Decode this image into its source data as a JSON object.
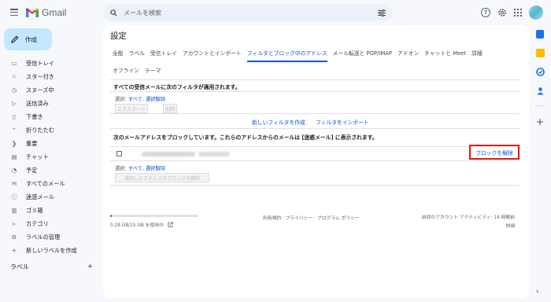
{
  "header": {
    "app_name": "Gmail",
    "search_placeholder": "メールを検索"
  },
  "compose_label": "作成",
  "nav": [
    {
      "icon": "inbox-icon",
      "glyph": "▭",
      "label": "受信トレイ"
    },
    {
      "icon": "star-icon",
      "glyph": "☆",
      "label": "スター付き"
    },
    {
      "icon": "snooze-icon",
      "glyph": "◷",
      "label": "スヌーズ中"
    },
    {
      "icon": "send-icon",
      "glyph": "▷",
      "label": "送信済み"
    },
    {
      "icon": "draft-icon",
      "glyph": "▯",
      "label": "下書き"
    },
    {
      "icon": "collapse-icon",
      "glyph": "⌃",
      "label": "折りたたむ"
    },
    {
      "icon": "important-icon",
      "glyph": "❯",
      "label": "重要"
    },
    {
      "icon": "chat-icon",
      "glyph": "▤",
      "label": "チャット"
    },
    {
      "icon": "scheduled-icon",
      "glyph": "◔",
      "label": "予定"
    },
    {
      "icon": "all-mail-icon",
      "glyph": "✉",
      "label": "すべてのメール"
    },
    {
      "icon": "spam-icon",
      "glyph": "ⓘ",
      "label": "迷惑メール"
    },
    {
      "icon": "trash-icon",
      "glyph": "▥",
      "label": "ゴミ箱"
    },
    {
      "icon": "category-icon",
      "glyph": "▹",
      "label": "カテゴリ"
    },
    {
      "icon": "manage-labels-icon",
      "glyph": "⚙",
      "label": "ラベルの管理"
    },
    {
      "icon": "add-label-icon",
      "glyph": "+",
      "label": "新しいラベルを作成"
    }
  ],
  "labels_heading": "ラベル",
  "labels_add": "+",
  "settings": {
    "title": "設定",
    "tabs": [
      "全般",
      "ラベル",
      "受信トレイ",
      "アカウントとインポート",
      "フィルタとブロック中のアドレス",
      "メール転送と POP/IMAP",
      "アドオン",
      "チャットと Meet",
      "詳細"
    ],
    "active_tab": 4,
    "tabs_row2": [
      "オフライン",
      "テーマ"
    ],
    "filters_heading": "すべての受信メールに次のフィルタが適用されます。",
    "select_label": "選択:",
    "select_all": "すべて",
    "select_none": "選択解除",
    "export_button": "エクスポート",
    "delete_button": "削除",
    "create_filter_link": "新しいフィルタを作成",
    "import_filter_link": "フィルタをインポート",
    "blocked_heading": "次のメールアドレスをブロックしています。これらのアドレスからのメールは [迷惑メール] に表示されます。",
    "unblock_link": "ブロックを解除",
    "unblock_selected_button": "選択したアドレスのブロックを解除"
  },
  "footer": {
    "storage_text": "0.28 GB/15 GB を使用中",
    "storage_fraction": 0.02,
    "policy_text": "利用規約 · プライバシー · プログラム ポリシー",
    "activity_text": "前回のアカウント アクティビティ: 14 時間前",
    "details_text": "詳細"
  }
}
